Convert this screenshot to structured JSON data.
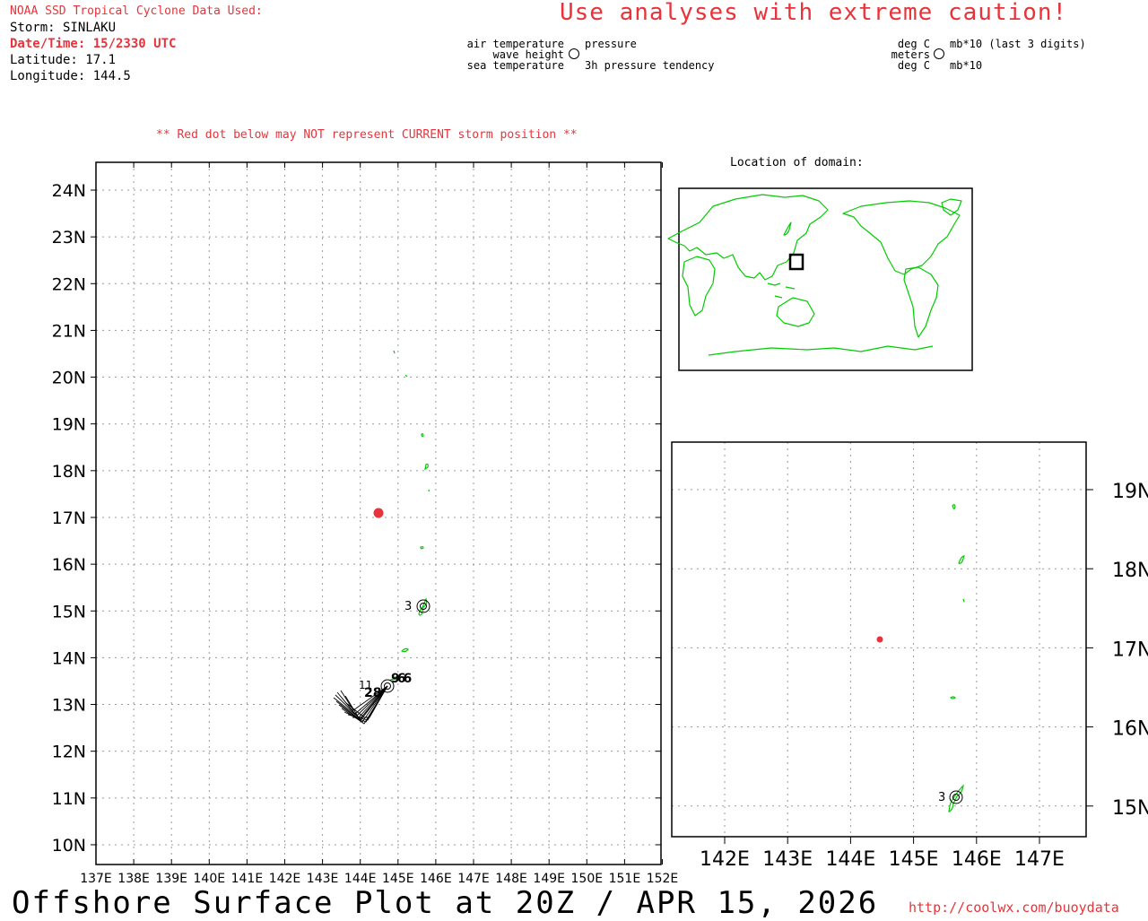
{
  "header": {
    "source": "NOAA SSD Tropical Cyclone Data Used:",
    "storm": "Storm: SINLAKU",
    "datetime": "Date/Time: 15/2330 UTC",
    "latitude": "Latitude: 17.1",
    "longitude": "Longitude: 144.5",
    "caution": "Use analyses with extreme caution!",
    "red_dot_note": "** Red dot below may NOT represent CURRENT storm position **"
  },
  "legend_center": {
    "air_temp": "air temperature",
    "wave_height": "wave height",
    "sea_temp": "sea temperature",
    "pressure": "pressure",
    "pressure_tendency": "3h pressure tendency"
  },
  "legend_right": {
    "deg_c_top": "deg C",
    "meters": "meters",
    "deg_c_bottom": "deg C",
    "mb_last3": "mb*10 (last 3 digits)",
    "mb": "mb*10"
  },
  "inset": {
    "title": "Location of domain:"
  },
  "main_map": {
    "lat_labels": [
      "24N",
      "23N",
      "22N",
      "21N",
      "20N",
      "19N",
      "18N",
      "17N",
      "16N",
      "15N",
      "14N",
      "13N",
      "12N",
      "11N",
      "10N"
    ],
    "lon_labels": [
      "137E",
      "138E",
      "139E",
      "140E",
      "141E",
      "142E",
      "143E",
      "144E",
      "145E",
      "146E",
      "147E",
      "148E",
      "149E",
      "150E",
      "151E",
      "152E"
    ],
    "station_labels": {
      "s1": "3",
      "s2": "11",
      "s3": "28",
      "s4": "966"
    }
  },
  "zoom_map": {
    "lat_labels": [
      "19N",
      "18N",
      "17N",
      "16N",
      "15N"
    ],
    "lon_labels": [
      "142E",
      "143E",
      "144E",
      "145E",
      "146E",
      "147E"
    ],
    "station_label": "3"
  },
  "footer": {
    "title": "Offshore Surface Plot at 20Z / APR 15, 2026",
    "url": "http://coolwx.com/buoydata"
  },
  "colors": {
    "storm_dot": "#e8333a",
    "coast": "#00cc00",
    "grid": "#9a9a9a"
  }
}
